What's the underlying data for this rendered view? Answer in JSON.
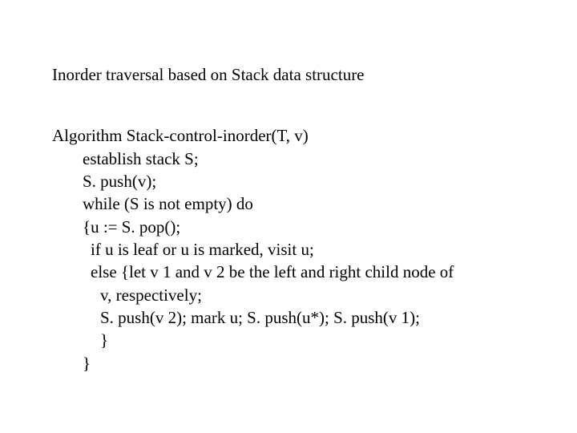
{
  "title": "Inorder traversal based on Stack data structure",
  "algorithm": {
    "header": "Algorithm Stack-control-inorder(T, v)",
    "lines": {
      "l1": "establish stack S;",
      "l2": "S. push(v);",
      "l3": "while (S is not empty) do",
      "l4": "{u := S. pop();",
      "l5": "if u is leaf or u is marked, visit u;",
      "l6": "else {let v 1 and v 2 be the left and right child node of",
      "l7": "v, respectively;",
      "l8": "S. push(v 2); mark u; S. push(u*); S. push(v 1);",
      "l9": "}",
      "l10": "}"
    }
  }
}
